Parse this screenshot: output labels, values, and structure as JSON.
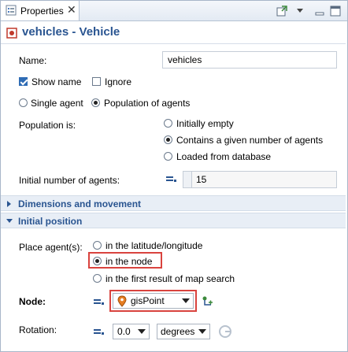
{
  "tab": {
    "label": "Properties"
  },
  "title": "vehicles - Vehicle",
  "name": {
    "label": "Name:",
    "value": "vehicles"
  },
  "show_name": {
    "label": "Show name",
    "checked": true
  },
  "ignore": {
    "label": "Ignore",
    "checked": false
  },
  "agent_mode": {
    "single": "Single agent",
    "population": "Population of agents",
    "selected": "population"
  },
  "population_is": {
    "label": "Population is:",
    "options": [
      "Initially empty",
      "Contains a given number of agents",
      "Loaded from database"
    ],
    "selected": 1
  },
  "initial_number": {
    "label": "Initial number of agents:",
    "value": "15"
  },
  "sections": {
    "dimensions": "Dimensions and movement",
    "initial_position": "Initial position"
  },
  "place_agents": {
    "label": "Place agent(s):",
    "options": [
      "in the latitude/longitude",
      "in the node",
      "in the first result of map search"
    ],
    "selected": 1
  },
  "node": {
    "label": "Node:",
    "value": "gisPoint"
  },
  "rotation": {
    "label": "Rotation:",
    "value": "0.0",
    "unit": "degrees"
  },
  "colors": {
    "accent": "#2a5591",
    "highlight": "#d9433e",
    "section_bg": "#e8eef6"
  }
}
